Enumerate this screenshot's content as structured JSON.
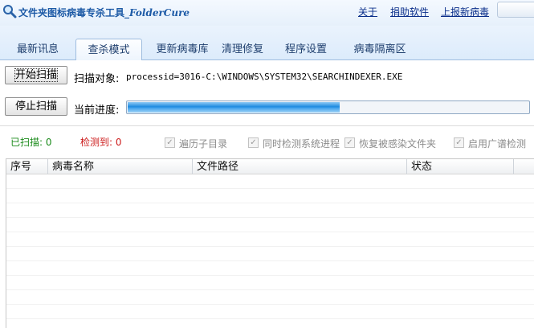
{
  "window": {
    "title_main": "文件夹图标病毒专杀工具_",
    "title_brand": "FolderCure",
    "icon": "magnifier-icon"
  },
  "header_links": [
    "关于",
    "捐助软件",
    "上报新病毒"
  ],
  "tabs": [
    "最新讯息",
    "查杀模式",
    "更新病毒库",
    "清理修复",
    "程序设置",
    "病毒隔离区"
  ],
  "active_tab": "查杀模式",
  "scan": {
    "start_button": "开始扫描",
    "target_label": "扫描对象:",
    "target_value": "processid=3016-C:\\WINDOWS\\SYSTEM32\\SEARCHINDEXER.EXE",
    "stop_button": "停止扫描",
    "progress_label": "当前进度:",
    "progress_fraction": 0.53
  },
  "stats": {
    "scanned_label": "已扫描:",
    "scanned_value": "0",
    "detected_label": "检测到:",
    "detected_value": "0",
    "scanned_color": "#1a8a1a",
    "detected_color": "#cc1a1a"
  },
  "options": [
    {
      "label": "遍历子目录",
      "checked": true,
      "enabled": false
    },
    {
      "label": "同时检测系统进程",
      "checked": true,
      "enabled": false
    },
    {
      "label": "恢复被感染文件夹",
      "checked": true,
      "enabled": false
    },
    {
      "label": "启用广谱检测",
      "checked": true,
      "enabled": false
    }
  ],
  "table": {
    "columns": [
      "序号",
      "病毒名称",
      "文件路径",
      "状态"
    ],
    "rows": []
  },
  "colors": {
    "title_text": "#1d5aa6",
    "accent_progress": "#1d8ae0"
  }
}
